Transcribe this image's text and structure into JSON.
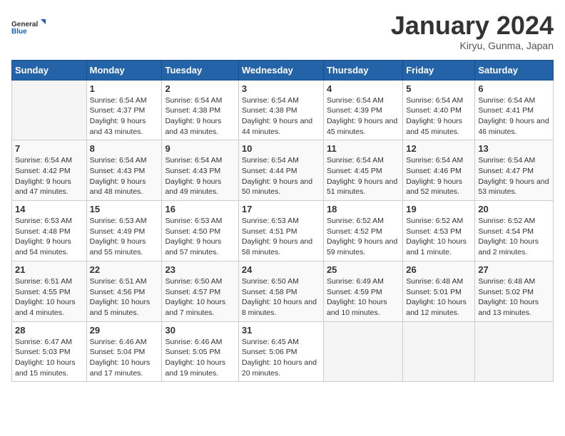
{
  "logo": {
    "line1": "General",
    "line2": "Blue"
  },
  "title": "January 2024",
  "subtitle": "Kiryu, Gunma, Japan",
  "headers": [
    "Sunday",
    "Monday",
    "Tuesday",
    "Wednesday",
    "Thursday",
    "Friday",
    "Saturday"
  ],
  "weeks": [
    [
      {
        "day": "",
        "sunrise": "",
        "sunset": "",
        "daylight": ""
      },
      {
        "day": "1",
        "sunrise": "Sunrise: 6:54 AM",
        "sunset": "Sunset: 4:37 PM",
        "daylight": "Daylight: 9 hours and 43 minutes."
      },
      {
        "day": "2",
        "sunrise": "Sunrise: 6:54 AM",
        "sunset": "Sunset: 4:38 PM",
        "daylight": "Daylight: 9 hours and 43 minutes."
      },
      {
        "day": "3",
        "sunrise": "Sunrise: 6:54 AM",
        "sunset": "Sunset: 4:38 PM",
        "daylight": "Daylight: 9 hours and 44 minutes."
      },
      {
        "day": "4",
        "sunrise": "Sunrise: 6:54 AM",
        "sunset": "Sunset: 4:39 PM",
        "daylight": "Daylight: 9 hours and 45 minutes."
      },
      {
        "day": "5",
        "sunrise": "Sunrise: 6:54 AM",
        "sunset": "Sunset: 4:40 PM",
        "daylight": "Daylight: 9 hours and 45 minutes."
      },
      {
        "day": "6",
        "sunrise": "Sunrise: 6:54 AM",
        "sunset": "Sunset: 4:41 PM",
        "daylight": "Daylight: 9 hours and 46 minutes."
      }
    ],
    [
      {
        "day": "7",
        "sunrise": "Sunrise: 6:54 AM",
        "sunset": "Sunset: 4:42 PM",
        "daylight": "Daylight: 9 hours and 47 minutes."
      },
      {
        "day": "8",
        "sunrise": "Sunrise: 6:54 AM",
        "sunset": "Sunset: 4:43 PM",
        "daylight": "Daylight: 9 hours and 48 minutes."
      },
      {
        "day": "9",
        "sunrise": "Sunrise: 6:54 AM",
        "sunset": "Sunset: 4:43 PM",
        "daylight": "Daylight: 9 hours and 49 minutes."
      },
      {
        "day": "10",
        "sunrise": "Sunrise: 6:54 AM",
        "sunset": "Sunset: 4:44 PM",
        "daylight": "Daylight: 9 hours and 50 minutes."
      },
      {
        "day": "11",
        "sunrise": "Sunrise: 6:54 AM",
        "sunset": "Sunset: 4:45 PM",
        "daylight": "Daylight: 9 hours and 51 minutes."
      },
      {
        "day": "12",
        "sunrise": "Sunrise: 6:54 AM",
        "sunset": "Sunset: 4:46 PM",
        "daylight": "Daylight: 9 hours and 52 minutes."
      },
      {
        "day": "13",
        "sunrise": "Sunrise: 6:54 AM",
        "sunset": "Sunset: 4:47 PM",
        "daylight": "Daylight: 9 hours and 53 minutes."
      }
    ],
    [
      {
        "day": "14",
        "sunrise": "Sunrise: 6:53 AM",
        "sunset": "Sunset: 4:48 PM",
        "daylight": "Daylight: 9 hours and 54 minutes."
      },
      {
        "day": "15",
        "sunrise": "Sunrise: 6:53 AM",
        "sunset": "Sunset: 4:49 PM",
        "daylight": "Daylight: 9 hours and 55 minutes."
      },
      {
        "day": "16",
        "sunrise": "Sunrise: 6:53 AM",
        "sunset": "Sunset: 4:50 PM",
        "daylight": "Daylight: 9 hours and 57 minutes."
      },
      {
        "day": "17",
        "sunrise": "Sunrise: 6:53 AM",
        "sunset": "Sunset: 4:51 PM",
        "daylight": "Daylight: 9 hours and 58 minutes."
      },
      {
        "day": "18",
        "sunrise": "Sunrise: 6:52 AM",
        "sunset": "Sunset: 4:52 PM",
        "daylight": "Daylight: 9 hours and 59 minutes."
      },
      {
        "day": "19",
        "sunrise": "Sunrise: 6:52 AM",
        "sunset": "Sunset: 4:53 PM",
        "daylight": "Daylight: 10 hours and 1 minute."
      },
      {
        "day": "20",
        "sunrise": "Sunrise: 6:52 AM",
        "sunset": "Sunset: 4:54 PM",
        "daylight": "Daylight: 10 hours and 2 minutes."
      }
    ],
    [
      {
        "day": "21",
        "sunrise": "Sunrise: 6:51 AM",
        "sunset": "Sunset: 4:55 PM",
        "daylight": "Daylight: 10 hours and 4 minutes."
      },
      {
        "day": "22",
        "sunrise": "Sunrise: 6:51 AM",
        "sunset": "Sunset: 4:56 PM",
        "daylight": "Daylight: 10 hours and 5 minutes."
      },
      {
        "day": "23",
        "sunrise": "Sunrise: 6:50 AM",
        "sunset": "Sunset: 4:57 PM",
        "daylight": "Daylight: 10 hours and 7 minutes."
      },
      {
        "day": "24",
        "sunrise": "Sunrise: 6:50 AM",
        "sunset": "Sunset: 4:58 PM",
        "daylight": "Daylight: 10 hours and 8 minutes."
      },
      {
        "day": "25",
        "sunrise": "Sunrise: 6:49 AM",
        "sunset": "Sunset: 4:59 PM",
        "daylight": "Daylight: 10 hours and 10 minutes."
      },
      {
        "day": "26",
        "sunrise": "Sunrise: 6:48 AM",
        "sunset": "Sunset: 5:01 PM",
        "daylight": "Daylight: 10 hours and 12 minutes."
      },
      {
        "day": "27",
        "sunrise": "Sunrise: 6:48 AM",
        "sunset": "Sunset: 5:02 PM",
        "daylight": "Daylight: 10 hours and 13 minutes."
      }
    ],
    [
      {
        "day": "28",
        "sunrise": "Sunrise: 6:47 AM",
        "sunset": "Sunset: 5:03 PM",
        "daylight": "Daylight: 10 hours and 15 minutes."
      },
      {
        "day": "29",
        "sunrise": "Sunrise: 6:46 AM",
        "sunset": "Sunset: 5:04 PM",
        "daylight": "Daylight: 10 hours and 17 minutes."
      },
      {
        "day": "30",
        "sunrise": "Sunrise: 6:46 AM",
        "sunset": "Sunset: 5:05 PM",
        "daylight": "Daylight: 10 hours and 19 minutes."
      },
      {
        "day": "31",
        "sunrise": "Sunrise: 6:45 AM",
        "sunset": "Sunset: 5:06 PM",
        "daylight": "Daylight: 10 hours and 20 minutes."
      },
      {
        "day": "",
        "sunrise": "",
        "sunset": "",
        "daylight": ""
      },
      {
        "day": "",
        "sunrise": "",
        "sunset": "",
        "daylight": ""
      },
      {
        "day": "",
        "sunrise": "",
        "sunset": "",
        "daylight": ""
      }
    ]
  ]
}
